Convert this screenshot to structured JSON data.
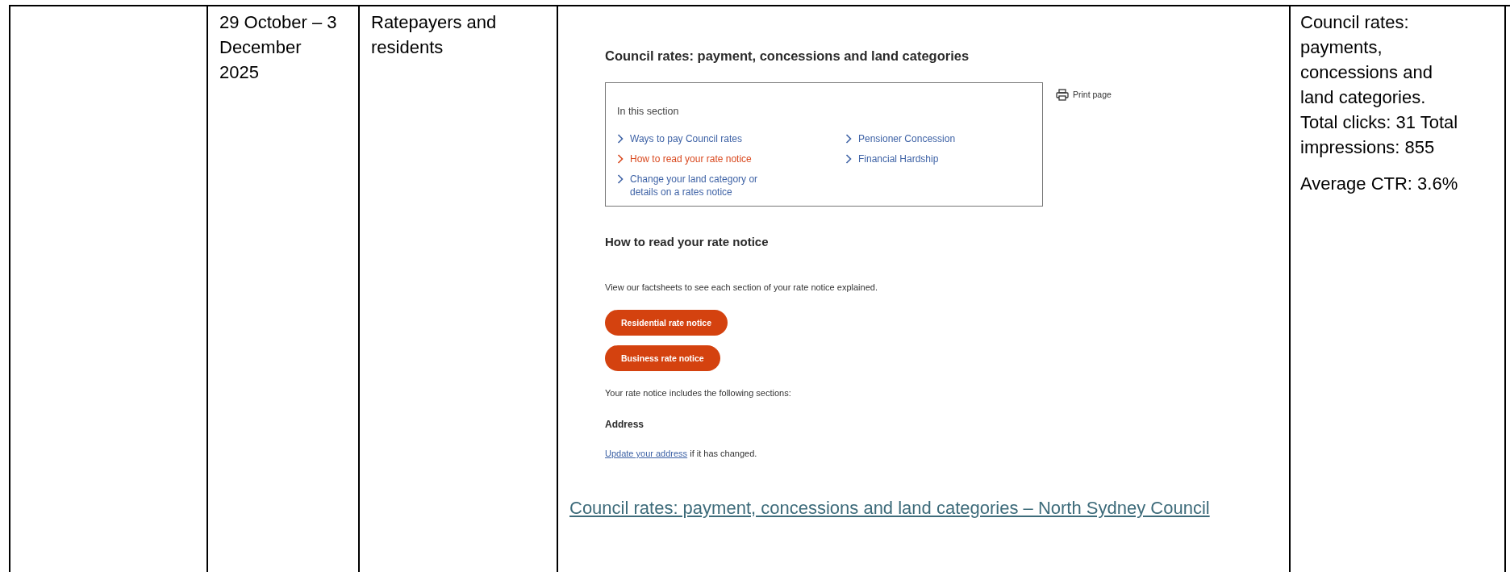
{
  "table_row": {
    "period": "29 October  – 3 December 2025",
    "audience": "Ratepayers and residents",
    "web_page": {
      "title": "Council rates: payment, concessions and land categories",
      "print_label": "Print page",
      "section_heading": "In this section",
      "section_columns": [
        {
          "links": [
            {
              "label": "Ways to pay Council rates",
              "selected": false
            },
            {
              "label": "How to read your rate notice",
              "selected": true
            },
            {
              "label": "Change your land category or details on a rates notice",
              "selected": false
            }
          ]
        },
        {
          "links": [
            {
              "label": "Pensioner Concession",
              "selected": false
            },
            {
              "label": "Financial Hardship",
              "selected": false
            }
          ]
        }
      ],
      "subheading": "How to read your rate notice",
      "intro": "View our factsheets to see each section of your rate notice explained.",
      "buttons": [
        "Residential rate notice",
        "Business rate notice"
      ],
      "includes_text": "Your rate notice includes the following sections:",
      "address_heading": "Address",
      "address_link": "Update your address",
      "address_text": " if it has changed."
    },
    "page_link": "Council rates: payment, concessions and land categories – North Sydney Council",
    "stats": [
      "Council rates: payments, concessions and land categories. Total clicks: 31 Total impressions: 855",
      "Average CTR: 3.6%"
    ]
  }
}
